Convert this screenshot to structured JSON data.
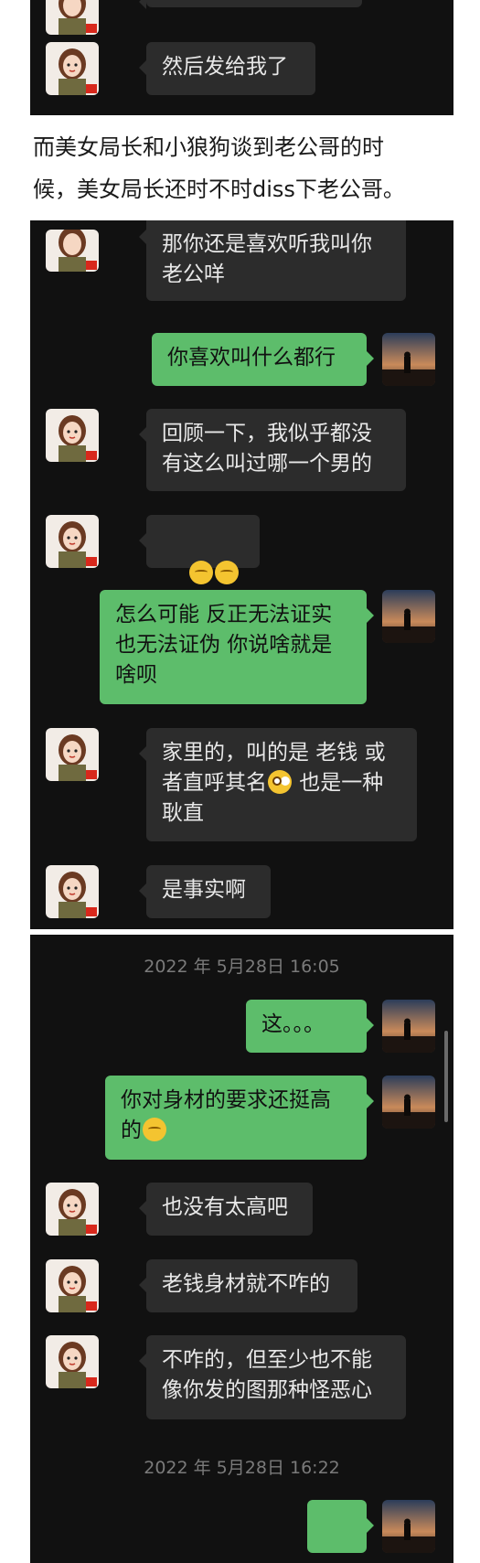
{
  "colors": {
    "chat_background": "#111111",
    "incoming_bubble": "#2c2c2c",
    "outgoing_bubble": "#5dbd6b",
    "incoming_text": "#e8e8e8",
    "timestamp_text": "#7a7a7a"
  },
  "icons": {
    "female_avatar": "cartoon-woman-avatar-with-flag",
    "male_avatar": "silhouette-sunset-avatar",
    "emoji_sleepy": "sleepy-face-emoji",
    "emoji_flushed": "flushed-face-emoji",
    "emoji_tongue": "face-savoring-food-emoji",
    "emoji_laugh": "crying-laughing-emoji"
  },
  "panel1": {
    "message_last": "然后发给我了"
  },
  "narration": {
    "line1": "而美女局长和小狼狗谈到老公哥的时",
    "line2": "候，美女局长还时不时diss下老公哥。"
  },
  "panel2": {
    "messages": [
      {
        "side": "in",
        "text": "那你还是喜欢听我叫你\n老公咩"
      },
      {
        "side": "out",
        "text": "你喜欢叫什么都行"
      },
      {
        "side": "in",
        "text": "回顾一下，我似乎都没\n有这么叫过哪一个男的"
      },
      {
        "side": "in",
        "text": ""
      },
      {
        "side": "out",
        "text": "怎么可能 反正无法证实\n也无法证伪 你说啥就是\n啥呗"
      },
      {
        "side": "in",
        "text_a": "家里的，叫的是 老钱 或\n者直呼其名",
        "text_b": " 也是一种\n耿直"
      },
      {
        "side": "in",
        "text": "是事实啊"
      }
    ]
  },
  "panel3": {
    "timestamp1": "2022 年 5月28日 16:05",
    "messages": [
      {
        "side": "out",
        "text": "这。。。"
      },
      {
        "side": "out",
        "text": "你对身材的要求还挺高\n的"
      },
      {
        "side": "in",
        "text": "也没有太高吧"
      },
      {
        "side": "in",
        "text": "老钱身材就不咋的"
      },
      {
        "side": "in",
        "text": "不咋的，但至少也不能\n像你发的图那种怪恶心"
      }
    ],
    "timestamp2": "2022 年 5月28日 16:22"
  }
}
